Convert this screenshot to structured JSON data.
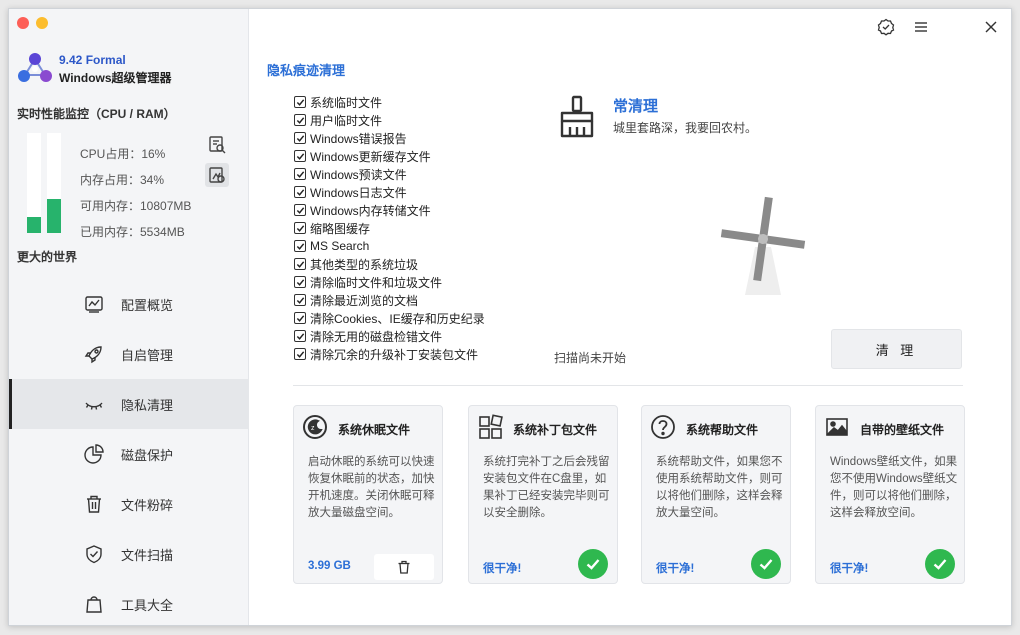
{
  "app": {
    "version": "9.42 Formal",
    "name": "Windows超级管理器"
  },
  "monitor": {
    "title": "实时性能监控（CPU / RAM）",
    "cpu_fill": 0.16,
    "mem_fill": 0.34,
    "cpu_label": "CPU占用：16%",
    "mem_label": "内存占用：34%",
    "avail_label": "可用内存：10807MB",
    "used_label": "已用内存：5534MB",
    "bar_color": "#27b36c"
  },
  "slogan": "更大的世界",
  "nav": [
    {
      "label": "配置概览",
      "icon": "chart-icon"
    },
    {
      "label": "自启管理",
      "icon": "rocket-icon"
    },
    {
      "label": "隐私清理",
      "icon": "eye-closed-icon",
      "active": true
    },
    {
      "label": "磁盘保护",
      "icon": "pie-icon"
    },
    {
      "label": "文件粉碎",
      "icon": "trash-icon"
    },
    {
      "label": "文件扫描",
      "icon": "shield-icon"
    },
    {
      "label": "工具大全",
      "icon": "bag-icon"
    }
  ],
  "main": {
    "section_title": "隐私痕迹清理",
    "checklist": [
      "系统临时文件",
      "用户临时文件",
      "Windows错误报告",
      "Windows更新缓存文件",
      "Windows预读文件",
      "Windows日志文件",
      "Windows内存转储文件",
      "缩略图缓存",
      "MS Search",
      "其他类型的系统垃圾",
      "清除临时文件和垃圾文件",
      "清除最近浏览的文档",
      "清除Cookies、IE缓存和历史纪录",
      "清除无用的磁盘检错文件",
      "清除冗余的升级补丁安装包文件"
    ],
    "tip_title": "常清理",
    "tip_text": "城里套路深，我要回农村。",
    "scan_status": "扫描尚未开始",
    "clean_button": "清 理"
  },
  "cards": [
    {
      "title": "系统休眠文件",
      "icon": "sleep-icon",
      "desc": "启动休眠的系统可以快速恢复休眠前的状态，加快开机速度。关闭休眠可释放大量磁盘空间。",
      "foot": "3.99 GB",
      "action": "trash"
    },
    {
      "title": "系统补丁包文件",
      "icon": "windows-icon",
      "desc": "系统打完补丁之后会残留安装包文件在C盘里，如果补丁已经安装完毕则可以安全删除。",
      "foot": "很干净!",
      "action": "ok"
    },
    {
      "title": "系统帮助文件",
      "icon": "question-icon",
      "desc": "系统帮助文件，如果您不使用系统帮助文件，则可以将他们删除，这样会释放大量空间。",
      "foot": "很干净!",
      "action": "ok"
    },
    {
      "title": "自带的壁纸文件",
      "icon": "image-icon",
      "desc": "Windows壁纸文件，如果您不使用Windows壁纸文件，则可以将他们删除，这样会释放空间。",
      "foot": "很干净!",
      "action": "ok"
    }
  ],
  "colors": {
    "accent": "#2c6fd6",
    "ok_green": "#2fb84f",
    "close_red": "#fd5f57",
    "minimize_yellow": "#fcbd2e"
  }
}
